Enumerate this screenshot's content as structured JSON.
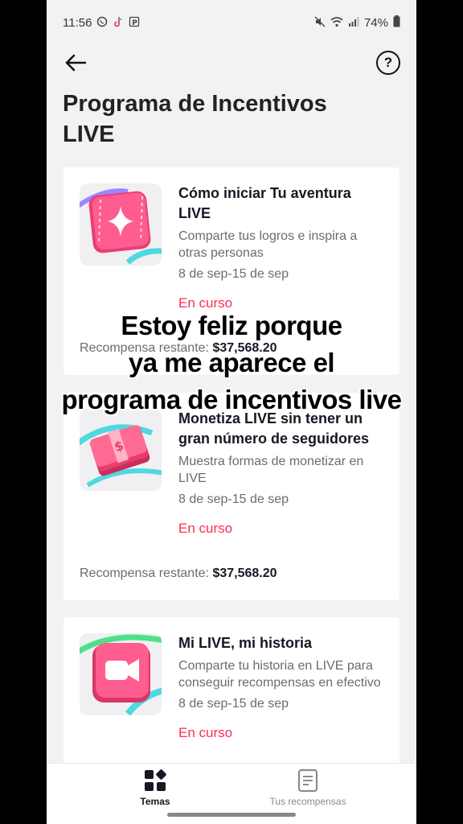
{
  "status_bar": {
    "time": "11:56",
    "battery": "74%",
    "left_icons": [
      "whatsapp-icon",
      "tiktok-icon",
      "parking-icon"
    ],
    "right_icons": [
      "mute-icon",
      "wifi-icon",
      "signal-icon",
      "battery-icon"
    ]
  },
  "header": {
    "back_icon": "arrow-left-icon",
    "help_label": "?",
    "title": "Programa de Incentivos LIVE"
  },
  "cards": [
    {
      "title": "Cómo iniciar Tu aventura LIVE",
      "description": "Comparte tus logros e inspira a otras personas",
      "date": "8 de sep-15 de sep",
      "status": "En curso",
      "reward_label": "Recompensa restante:",
      "reward_value": "$37,568.20",
      "icon": "sparkle-card-icon"
    },
    {
      "title": "Monetiza LIVE sin tener un gran número de seguidores",
      "description": "Muestra formas de monetizar en LIVE",
      "date": "8 de sep-15 de sep",
      "status": "En curso",
      "reward_label": "Recompensa restante:",
      "reward_value": "$37,568.20",
      "icon": "money-stack-icon"
    },
    {
      "title": "Mi LIVE, mi historia",
      "description": "Comparte tu historia en LIVE para conseguir recompensas en efectivo",
      "date": "8 de sep-15 de sep",
      "status": "En curso",
      "icon": "video-camera-icon"
    }
  ],
  "caption": {
    "line1": "Estoy feliz porque",
    "line2": "ya me aparece el",
    "line3": "programa de incentivos live"
  },
  "bottom_nav": [
    {
      "label": "Temas",
      "icon": "grid-icon",
      "active": true
    },
    {
      "label": "Tus recompensas",
      "icon": "document-icon",
      "active": false
    }
  ],
  "colors": {
    "accent": "#fe2c55",
    "background": "#f2f2f2",
    "card": "#ffffff"
  }
}
